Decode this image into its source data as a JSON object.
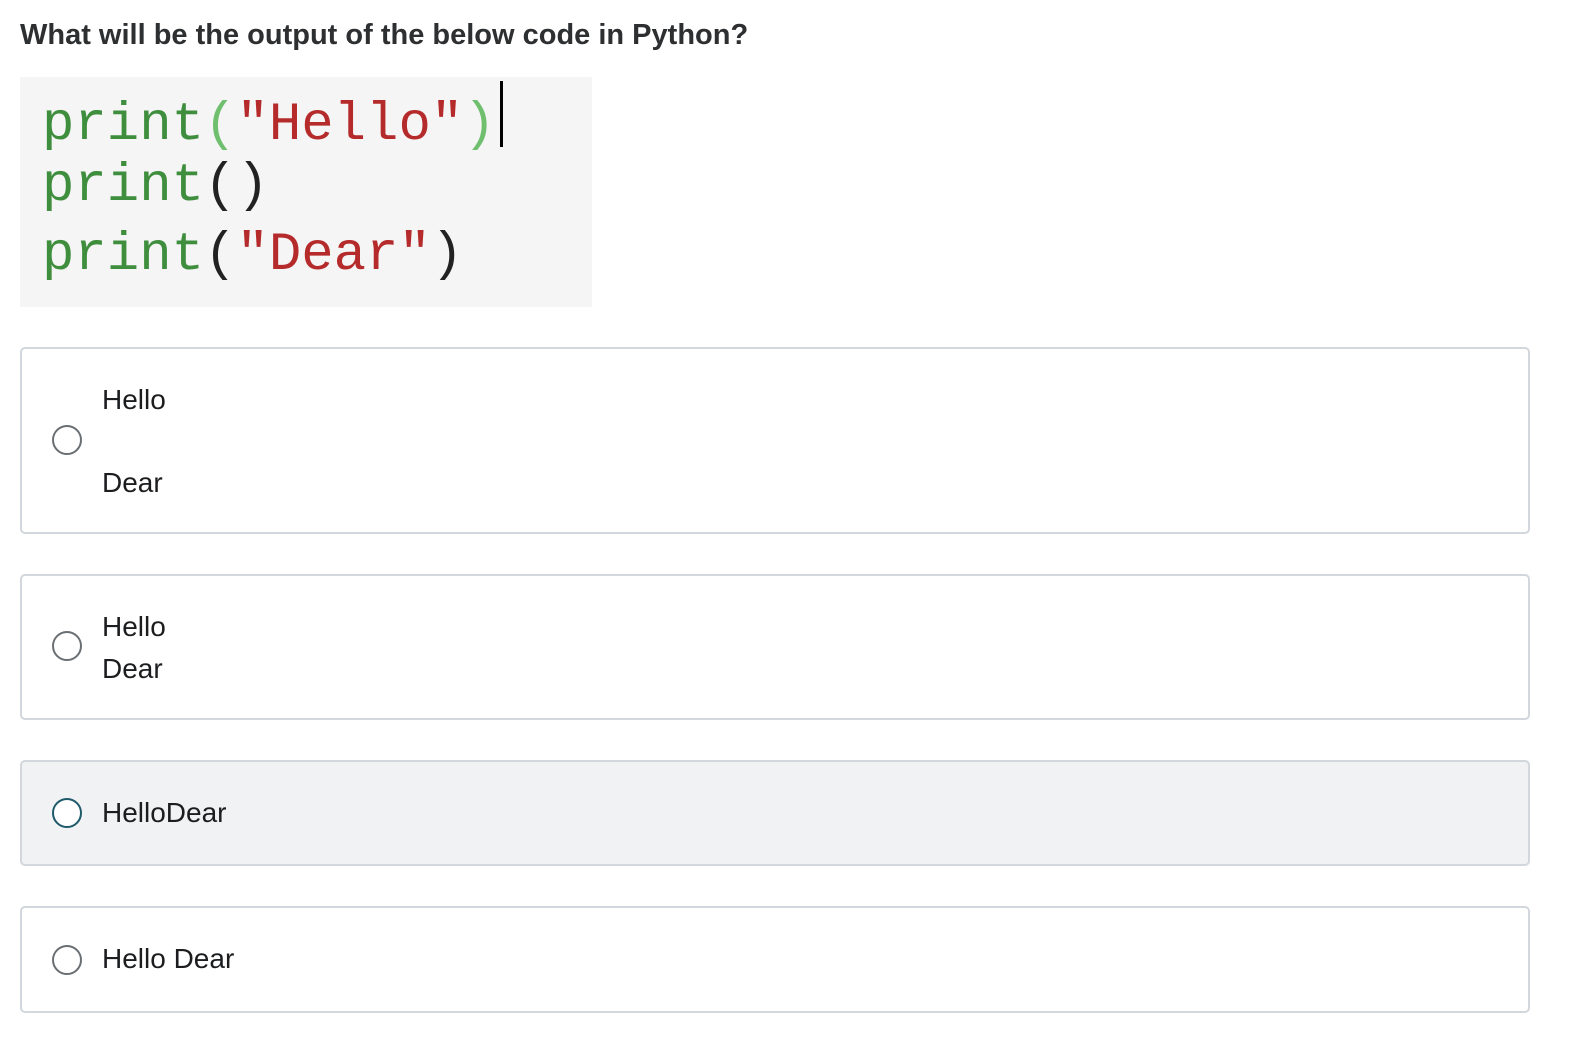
{
  "question": "What will be the output of the below code in Python?",
  "code": {
    "line1": {
      "fn": "print",
      "open": "(",
      "arg": "\"Hello\"",
      "close": ")"
    },
    "line2": {
      "fn": "print",
      "open": "(",
      "close": ")"
    },
    "line3": {
      "fn": "print",
      "open": "(",
      "arg": "\"Dear\"",
      "close": ")"
    }
  },
  "options": [
    {
      "lines": [
        "Hello",
        "Dear"
      ]
    },
    {
      "lines": [
        "Hello",
        "Dear"
      ]
    },
    {
      "lines": [
        "HelloDear"
      ]
    },
    {
      "lines": [
        "Hello Dear"
      ]
    }
  ],
  "colors": {
    "code_keyword": "#3e8e3e",
    "code_string": "#b52b2b",
    "hovered_option_bg": "#f1f2f3",
    "border": "#d1d7dc"
  }
}
